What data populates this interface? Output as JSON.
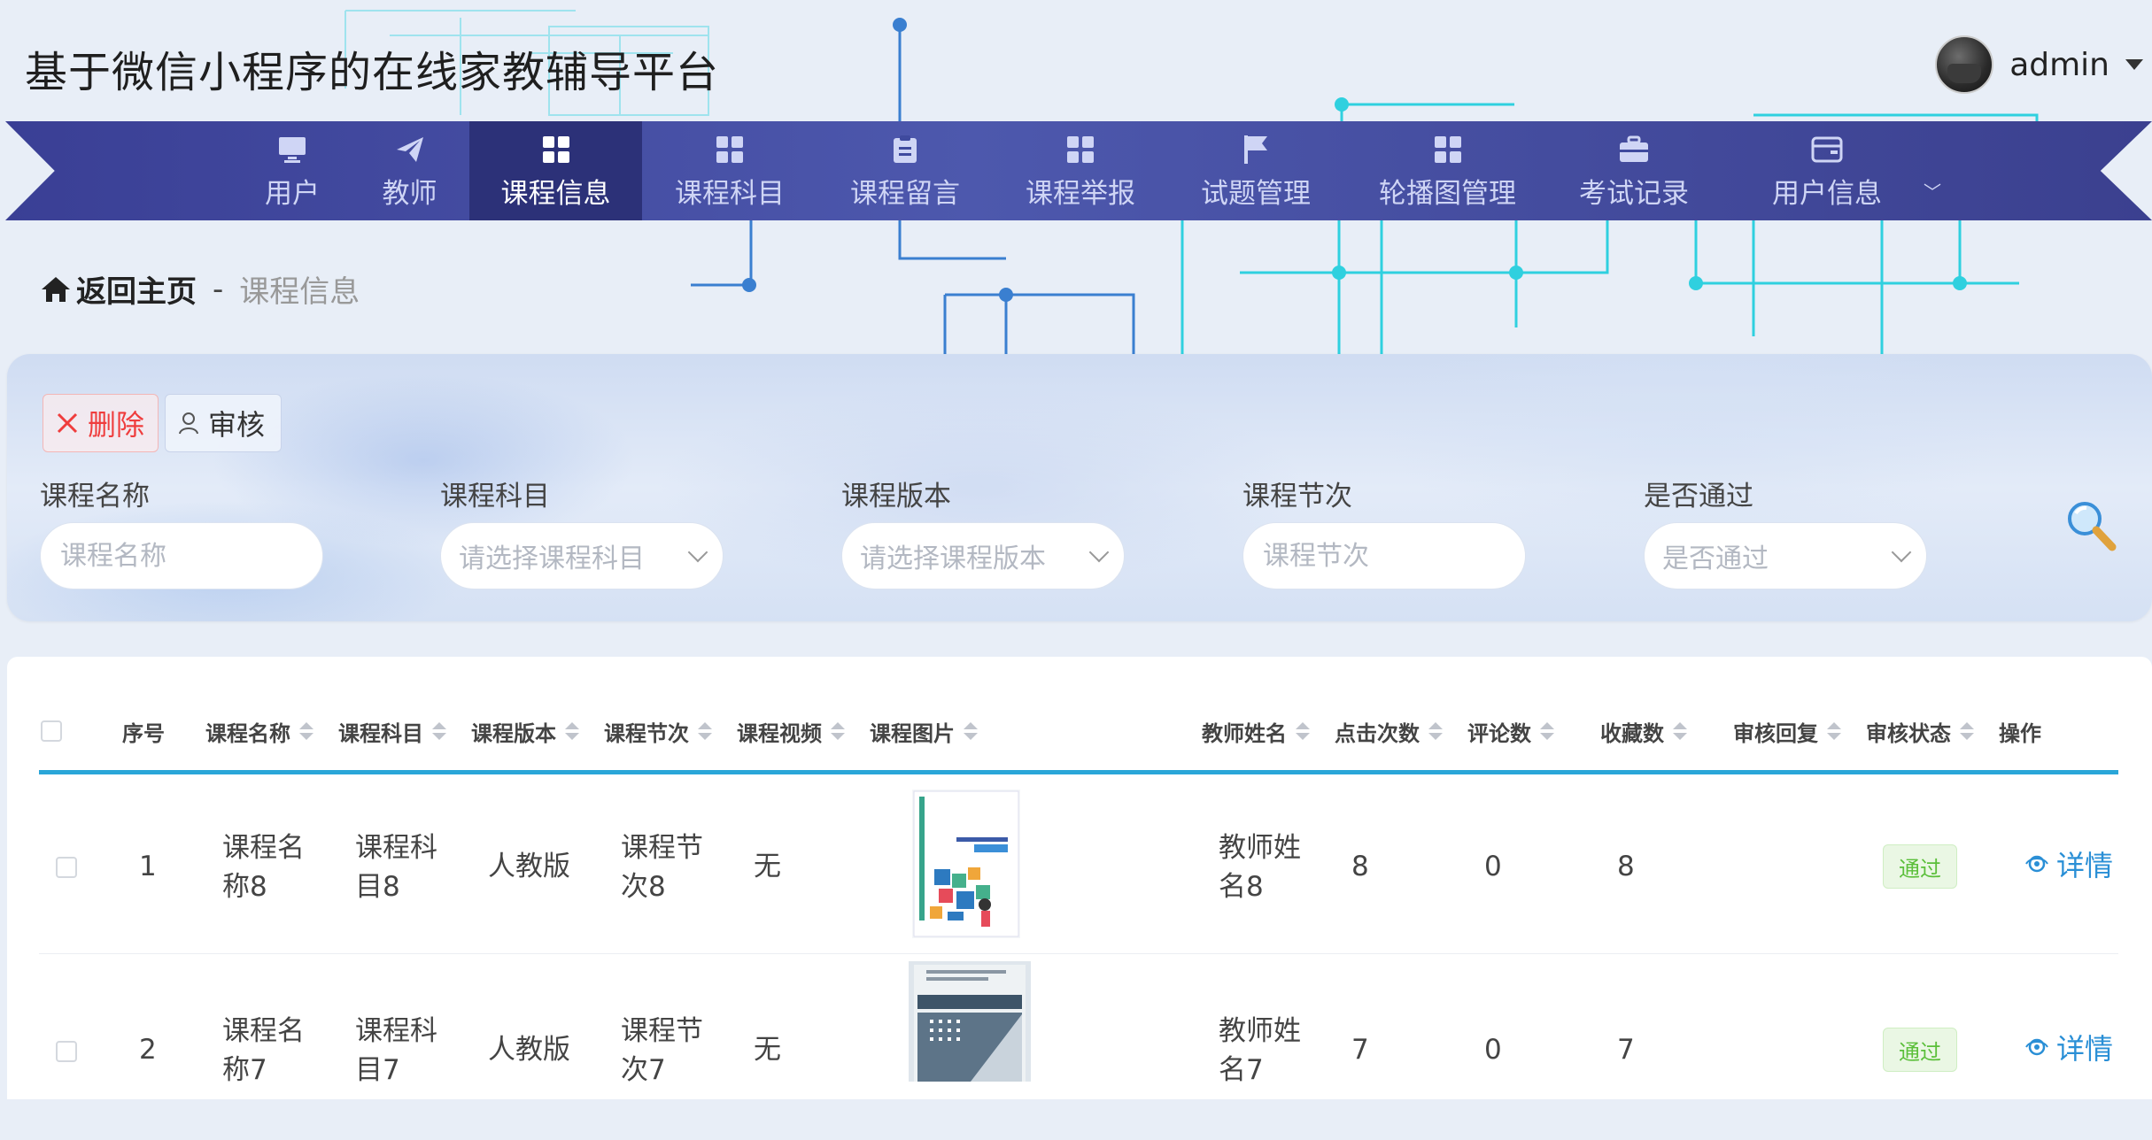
{
  "header": {
    "site_title": "基于微信小程序的在线家教辅导平台",
    "user_name": "admin"
  },
  "nav": {
    "items": [
      {
        "label": "用户",
        "icon": "monitor-icon"
      },
      {
        "label": "教师",
        "icon": "paper-plane-icon"
      },
      {
        "label": "课程信息",
        "icon": "grid-icon",
        "active": true
      },
      {
        "label": "课程科目",
        "icon": "grid-icon"
      },
      {
        "label": "课程留言",
        "icon": "clipboard-icon"
      },
      {
        "label": "课程举报",
        "icon": "grid-icon"
      },
      {
        "label": "试题管理",
        "icon": "flag-icon"
      },
      {
        "label": "轮播图管理",
        "icon": "grid-icon"
      },
      {
        "label": "考试记录",
        "icon": "briefcase-icon"
      },
      {
        "label": "用户信息",
        "icon": "wallet-icon"
      }
    ]
  },
  "breadcrumb": {
    "home": "返回主页",
    "separator": "-",
    "current": "课程信息"
  },
  "actions": {
    "delete_label": "删除",
    "audit_label": "审核"
  },
  "filters": [
    {
      "label": "课程名称",
      "placeholder": "课程名称",
      "type": "input"
    },
    {
      "label": "课程科目",
      "placeholder": "请选择课程科目",
      "type": "select"
    },
    {
      "label": "课程版本",
      "placeholder": "请选择课程版本",
      "type": "select"
    },
    {
      "label": "课程节次",
      "placeholder": "课程节次",
      "type": "input"
    },
    {
      "label": "是否通过",
      "placeholder": "是否通过",
      "type": "select"
    }
  ],
  "table": {
    "columns": [
      "序号",
      "课程名称",
      "课程科目",
      "课程版本",
      "课程节次",
      "课程视频",
      "课程图片",
      "教师姓名",
      "点击次数",
      "评论数",
      "收藏数",
      "审核回复",
      "审核状态",
      "操作"
    ],
    "rows": [
      {
        "index": "1",
        "name": [
          "课程名",
          "称8"
        ],
        "subject": [
          "课程科",
          "目8"
        ],
        "version": "人教版",
        "section": [
          "课程节",
          "次8"
        ],
        "video": "无",
        "teacher": [
          "教师姓",
          "名8"
        ],
        "clicks": "8",
        "comments": "0",
        "favorites": "8",
        "reply": "",
        "status": "通过",
        "action": "详情"
      },
      {
        "index": "2",
        "name": [
          "课程名",
          "称7"
        ],
        "subject": [
          "课程科",
          "目7"
        ],
        "version": "人教版",
        "section": [
          "课程节",
          "次7"
        ],
        "video": "无",
        "teacher": [
          "教师姓",
          "名7"
        ],
        "clicks": "7",
        "comments": "0",
        "favorites": "7",
        "reply": "",
        "status": "通过",
        "action": "详情"
      }
    ]
  },
  "colors": {
    "nav_bg": "#4450a3",
    "nav_active": "#2c3178",
    "accent_line": "#2aa6d8",
    "delete": "#ef3d3d",
    "link": "#2a8fd6",
    "status_ok": "#5bbf3a"
  }
}
